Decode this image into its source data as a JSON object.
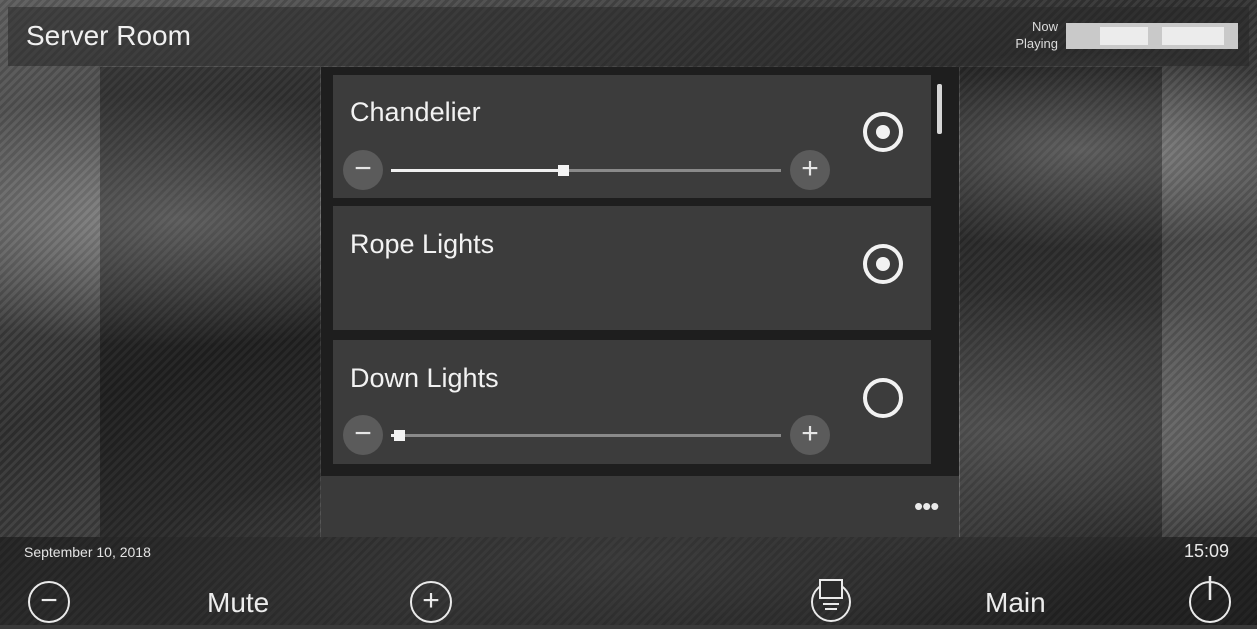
{
  "header": {
    "room_title": "Server Room",
    "now_playing_label": "Now Playing"
  },
  "lights": [
    {
      "name": "Chandelier",
      "state": "on",
      "level_percent": 44,
      "has_slider": true,
      "minus_label": "−",
      "plus_label": "+"
    },
    {
      "name": "Rope Lights",
      "state": "on",
      "has_slider": false
    },
    {
      "name": "Down Lights",
      "state": "off",
      "level_percent": 2,
      "has_slider": true,
      "minus_label": "−",
      "plus_label": "+"
    }
  ],
  "panel": {
    "more_label": "•••"
  },
  "footer": {
    "date": "September 10, 2018",
    "time": "15:09",
    "volume_down_label": "−",
    "mute_label": "Mute",
    "volume_up_label": "+",
    "main_label": "Main"
  },
  "icons": {
    "source": "source-select-icon",
    "power": "power-icon"
  },
  "colors": {
    "accent": "#f2f2f2",
    "card": "#3c3c3c",
    "panel": "#1e1e1e"
  }
}
